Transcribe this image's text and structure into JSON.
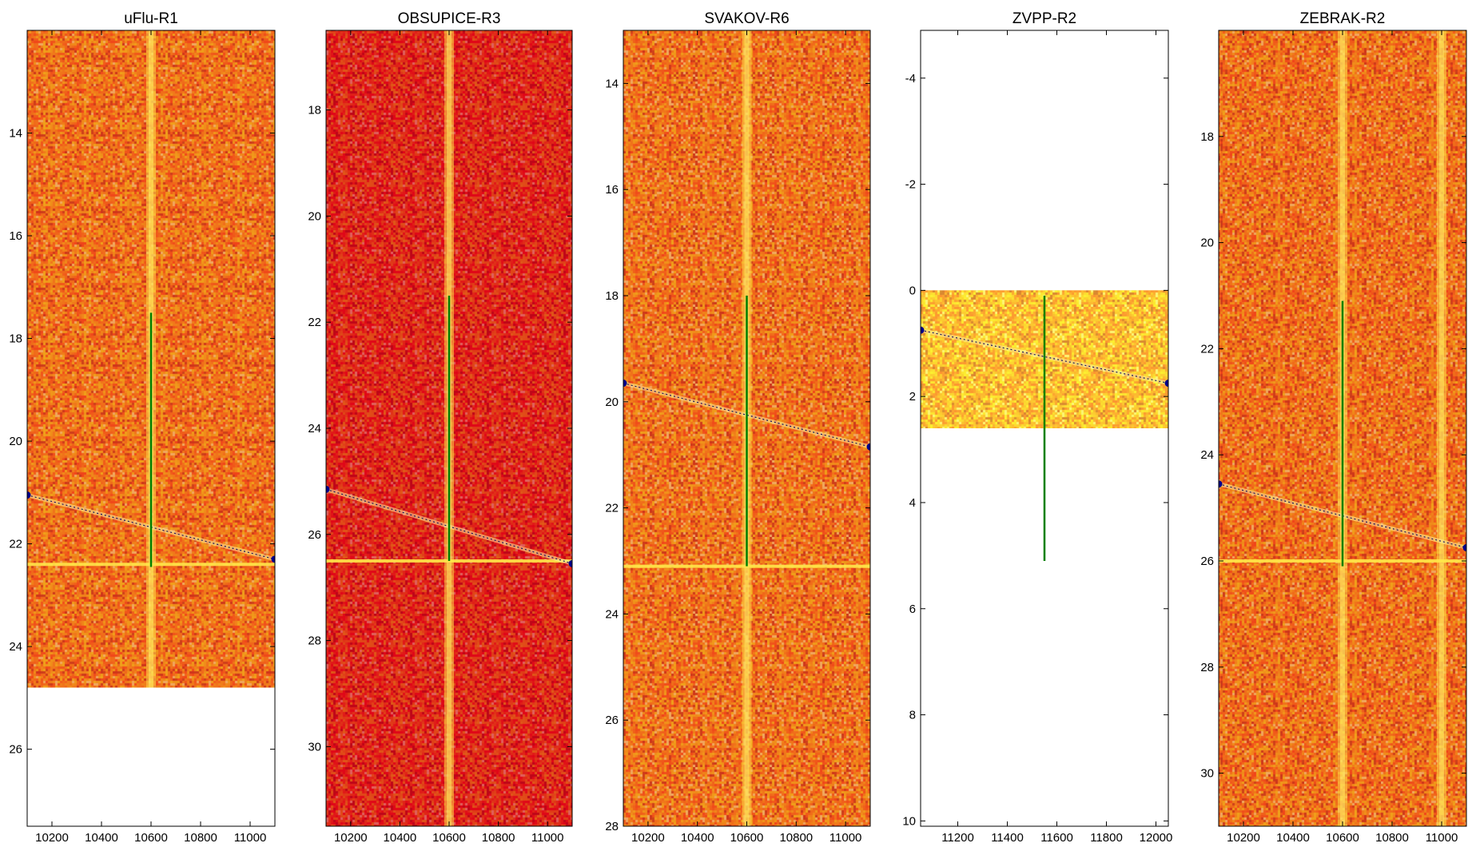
{
  "chart_data": [
    {
      "type": "heatmap",
      "title": "uFlu-R1",
      "xlim": [
        10100,
        11100
      ],
      "ylim": [
        27.5,
        12.0
      ],
      "xticks": [
        10200,
        10400,
        10600,
        10800,
        11000
      ],
      "yticks": [
        14,
        16,
        18,
        20,
        22,
        24,
        26
      ],
      "data_extent": {
        "y": [
          12.0,
          24.8
        ]
      },
      "colormap": "autumn",
      "base_color": "#f0701a",
      "marker_color": "#00008b",
      "vertical_lines": [
        {
          "x": 10600,
          "y": [
            17.5,
            22.45
          ],
          "color": "#008000"
        }
      ],
      "horizontal_bands": [
        22.4
      ],
      "vertical_bands": [
        10600
      ],
      "track": {
        "start": [
          10100,
          21.05
        ],
        "end": [
          11100,
          22.3
        ]
      }
    },
    {
      "type": "heatmap",
      "title": "OBSUPICE-R3",
      "xlim": [
        10100,
        11100
      ],
      "ylim": [
        31.5,
        16.5
      ],
      "xticks": [
        10200,
        10400,
        10600,
        10800,
        11000
      ],
      "yticks": [
        18,
        20,
        22,
        24,
        26,
        28,
        30
      ],
      "data_extent": {
        "y": [
          16.5,
          31.5
        ]
      },
      "colormap": "autumn",
      "base_color": "#e02818",
      "marker_color": "#00008b",
      "vertical_lines": [
        {
          "x": 10600,
          "y": [
            21.5,
            26.5
          ],
          "color": "#008000"
        }
      ],
      "horizontal_bands": [
        26.5
      ],
      "vertical_bands": [
        10600
      ],
      "track": {
        "start": [
          10100,
          25.15
        ],
        "end": [
          11100,
          26.55
        ]
      }
    },
    {
      "type": "heatmap",
      "title": "SVAKOV-R6",
      "xlim": [
        10100,
        11100
      ],
      "ylim": [
        28.0,
        13.0
      ],
      "xticks": [
        10200,
        10400,
        10600,
        10800,
        11000
      ],
      "yticks": [
        14,
        16,
        18,
        20,
        22,
        24,
        26,
        28
      ],
      "data_extent": {
        "y": [
          13.0,
          28.0
        ]
      },
      "colormap": "autumn",
      "base_color": "#f0701a",
      "marker_color": "#00008b",
      "vertical_lines": [
        {
          "x": 10600,
          "y": [
            18.0,
            23.1
          ],
          "color": "#008000"
        }
      ],
      "horizontal_bands": [
        23.1
      ],
      "vertical_bands": [
        10600
      ],
      "track": {
        "start": [
          10100,
          19.65
        ],
        "end": [
          11100,
          20.85
        ]
      }
    },
    {
      "type": "heatmap",
      "title": "ZVPP-R2",
      "xlim": [
        11050,
        12050
      ],
      "ylim": [
        10.1,
        -4.9
      ],
      "xticks": [
        11200,
        11400,
        11600,
        11800,
        12000
      ],
      "yticks": [
        -4,
        -2,
        0,
        2,
        4,
        6,
        8,
        10
      ],
      "data_extent": {
        "y": [
          0.0,
          2.6
        ]
      },
      "colormap": "autumn",
      "base_color": "#fcc030",
      "marker_color": "#00008b",
      "vertical_lines": [
        {
          "x": 11550,
          "y": [
            0.1,
            5.1
          ],
          "color": "#008000"
        }
      ],
      "horizontal_bands": [],
      "vertical_bands": [],
      "track": {
        "start": [
          11050,
          0.75
        ],
        "end": [
          12050,
          1.75
        ]
      }
    },
    {
      "type": "heatmap",
      "title": "ZEBRAK-R2",
      "xlim": [
        10100,
        11100
      ],
      "ylim": [
        31.0,
        16.0
      ],
      "xticks": [
        10200,
        10400,
        10600,
        10800,
        11000
      ],
      "yticks": [
        18,
        20,
        22,
        24,
        26,
        28,
        30
      ],
      "data_extent": {
        "y": [
          16.0,
          31.0
        ]
      },
      "colormap": "autumn",
      "base_color": "#f0701a",
      "marker_color": "#00008b",
      "vertical_lines": [
        {
          "x": 10600,
          "y": [
            21.1,
            26.1
          ],
          "color": "#008000"
        }
      ],
      "horizontal_bands": [
        26.0
      ],
      "vertical_bands": [
        10600,
        11000
      ],
      "track": {
        "start": [
          10100,
          24.55
        ],
        "end": [
          11100,
          25.75
        ]
      }
    }
  ]
}
